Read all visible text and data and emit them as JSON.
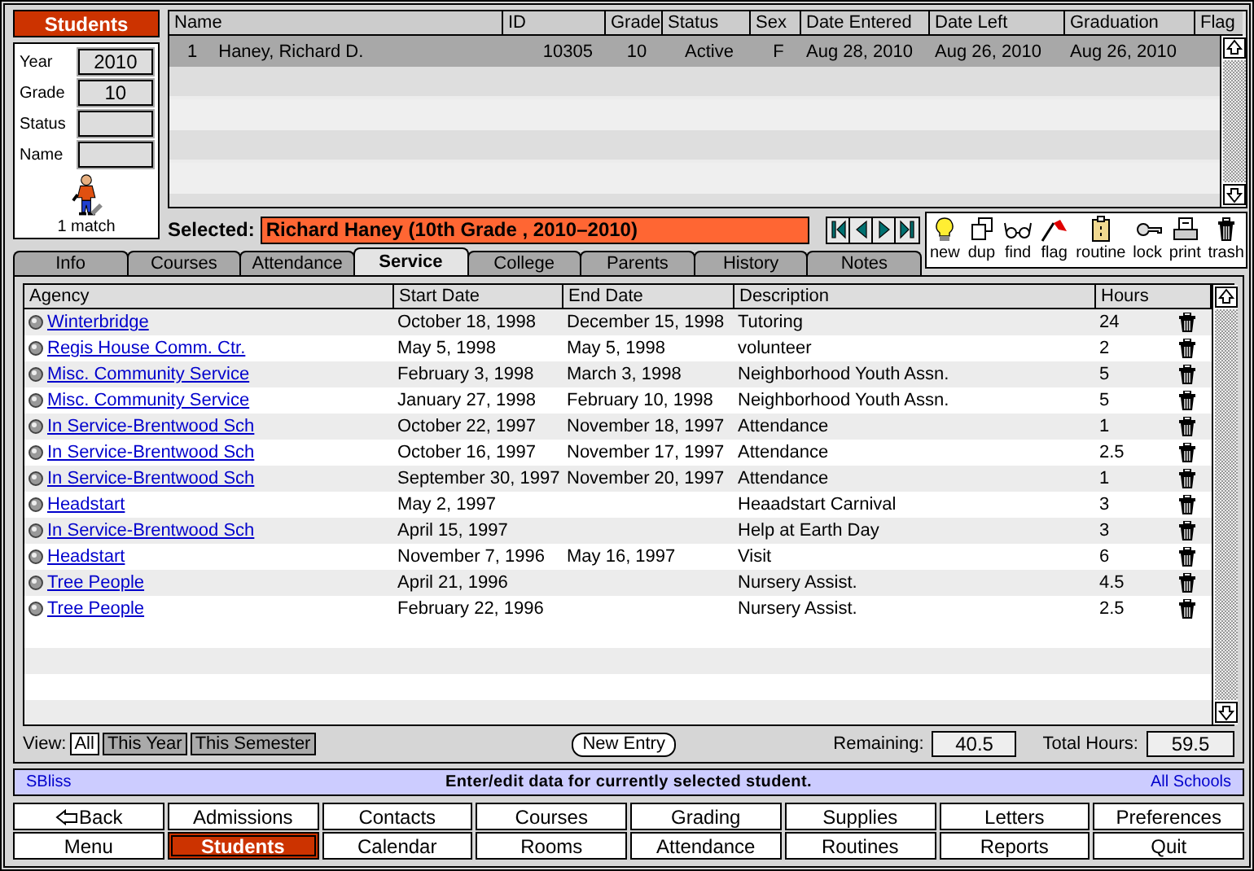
{
  "sidebar": {
    "title": "Students",
    "filters": [
      {
        "label": "Year",
        "value": "2010"
      },
      {
        "label": "Grade",
        "value": "10"
      },
      {
        "label": "Status"
      },
      {
        "label": "Name"
      }
    ],
    "match_count": "1 match"
  },
  "students": {
    "columns": [
      "Name",
      "ID",
      "Grade",
      "Status",
      "Sex",
      "Date Entered",
      "Date Left",
      "Graduation",
      "Flag"
    ],
    "rows": [
      {
        "number": "1",
        "name": "Haney, Richard D.",
        "id": "10305",
        "grade": "10",
        "status": "Active",
        "sex": "F",
        "date_entered": "Aug 28, 2010",
        "date_left": "Aug 26, 2010",
        "graduation": "Aug 26, 2010",
        "selected": true
      }
    ]
  },
  "selected": {
    "label": "Selected:",
    "value": "Richard Haney (10th Grade , 2010–2010)"
  },
  "toolbar": [
    "new",
    "dup",
    "find",
    "flag",
    "routine",
    "lock",
    "print",
    "trash"
  ],
  "tabs": [
    {
      "label": "Info",
      "selected": false
    },
    {
      "label": "Courses",
      "selected": false
    },
    {
      "label": "Attendance",
      "selected": false
    },
    {
      "label": "Service",
      "selected": true
    },
    {
      "label": "College",
      "selected": false
    },
    {
      "label": "Parents",
      "selected": false
    },
    {
      "label": "History",
      "selected": false
    },
    {
      "label": "Notes",
      "selected": false
    }
  ],
  "service": {
    "columns": [
      "Agency",
      "Start Date",
      "End Date",
      "Description",
      "Hours"
    ],
    "rows": [
      {
        "agency": "Winterbridge",
        "start": "October 18, 1998",
        "end": "December 15, 1998",
        "description": "Tutoring",
        "hours": "24"
      },
      {
        "agency": "Regis House Comm. Ctr.",
        "start": "May 5, 1998",
        "end": "May 5, 1998",
        "description": "volunteer",
        "hours": "2"
      },
      {
        "agency": "Misc. Community Service",
        "start": "February 3, 1998",
        "end": "March 3, 1998",
        "description": "Neighborhood Youth Assn.",
        "hours": "5"
      },
      {
        "agency": "Misc. Community Service",
        "start": "January 27, 1998",
        "end": "February 10, 1998",
        "description": "Neighborhood Youth Assn.",
        "hours": "5"
      },
      {
        "agency": "In Service-Brentwood Sch",
        "start": "October 22, 1997",
        "end": "November 18, 1997",
        "description": "Attendance",
        "hours": "1"
      },
      {
        "agency": "In Service-Brentwood Sch",
        "start": "October 16, 1997",
        "end": "November 17, 1997",
        "description": "Attendance",
        "hours": "2.5"
      },
      {
        "agency": "In Service-Brentwood Sch",
        "start": "September 30, 1997",
        "end": "November 20, 1997",
        "description": "Attendance",
        "hours": "1"
      },
      {
        "agency": "Headstart",
        "start": "May 2, 1997",
        "description": "Heaadstart Carnival",
        "hours": "3"
      },
      {
        "agency": "In Service-Brentwood Sch",
        "start": "April 15, 1997",
        "description": "Help at Earth Day",
        "hours": "3"
      },
      {
        "agency": "Headstart",
        "start": "November 7, 1996",
        "end": "May 16, 1997",
        "description": "Visit",
        "hours": "6"
      },
      {
        "agency": "Tree People",
        "start": "April 21, 1996",
        "description": "Nursery Assist.",
        "hours": "4.5"
      },
      {
        "agency": "Tree People",
        "start": "February 22, 1996",
        "description": "Nursery Assist.",
        "hours": "2.5"
      }
    ],
    "view_label": "View:",
    "view_options": [
      {
        "label": "All",
        "selected": true
      },
      {
        "label": "This Year",
        "selected": false
      },
      {
        "label": "This Semester",
        "selected": false
      }
    ],
    "new_entry": "New Entry",
    "remaining_label": "Remaining:",
    "remaining": "40.5",
    "total_label": "Total Hours:",
    "total": "59.5"
  },
  "status_bar": {
    "user": "SBliss",
    "message": "Enter/edit data for currently selected student.",
    "scope": "All Schools"
  },
  "nav_buttons": [
    {
      "label": "Back",
      "selected": false
    },
    {
      "label": "Admissions",
      "selected": false
    },
    {
      "label": "Contacts",
      "selected": false
    },
    {
      "label": "Courses",
      "selected": false
    },
    {
      "label": "Grading",
      "selected": false
    },
    {
      "label": "Supplies",
      "selected": false
    },
    {
      "label": "Letters",
      "selected": false
    },
    {
      "label": "Preferences",
      "selected": false
    },
    {
      "label": "Menu",
      "selected": false
    },
    {
      "label": "Students",
      "selected": true
    },
    {
      "label": "Calendar",
      "selected": false
    },
    {
      "label": "Rooms",
      "selected": false
    },
    {
      "label": "Attendance",
      "selected": false
    },
    {
      "label": "Routines",
      "selected": false
    },
    {
      "label": "Reports",
      "selected": false
    },
    {
      "label": "Quit",
      "selected": false
    }
  ]
}
